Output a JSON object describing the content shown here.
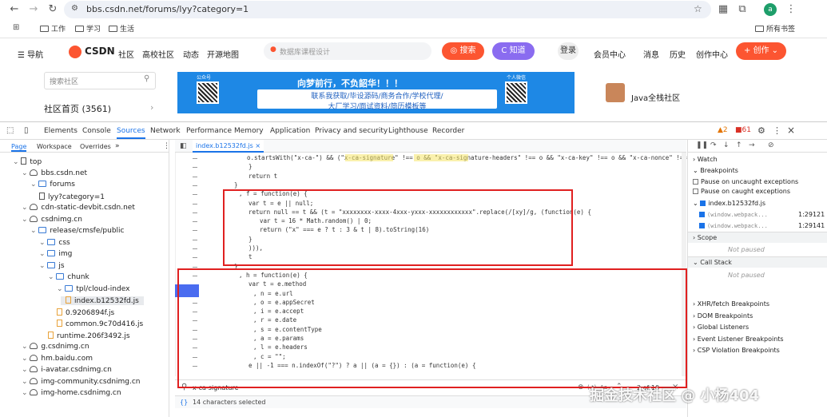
{
  "browser": {
    "url": "bbs.csdn.net/forums/lyy?category=1",
    "avatar_letter": "a",
    "bookmarks": [
      "工作",
      "学习",
      "生活"
    ],
    "all_bookmarks": "所有书签"
  },
  "site": {
    "nav_items": [
      "导航",
      "社区",
      "高校社区",
      "动态",
      "开源地图"
    ],
    "logo": "CSDN",
    "search_placeholder": "数据库课程设计",
    "search_button": "搜索",
    "zhidao_button": "知道",
    "login": "登录",
    "right_items": [
      "会员中心",
      "消息",
      "历史",
      "创作中心"
    ],
    "create_button": "创作",
    "sidebar_search_placeholder": "搜索社区",
    "community_home": "社区首页 (3561)",
    "banner_title": "向梦前行，不负韶华！！！",
    "banner_subtitle": "联系我获取/毕设源码/商务合作/学校代理/",
    "banner_subtitle2": "大厂学习/面试资料/简历模板等",
    "banner_left_label": "公众号",
    "banner_right_label": "个人微信",
    "community_name": "Java全栈社区"
  },
  "devtools": {
    "tabs": [
      "Elements",
      "Console",
      "Sources",
      "Network",
      "Performance",
      "Memory",
      "Application",
      "Privacy and security",
      "Lighthouse",
      "Recorder"
    ],
    "active_tab": "Sources",
    "warnings": "2",
    "errors": "61",
    "nav_tabs": [
      "Page",
      "Workspace",
      "Overrides"
    ],
    "file_tab": "index.b12532fd.js",
    "tree": [
      {
        "label": "top",
        "indent": 0,
        "icon": "frame"
      },
      {
        "label": "bbs.csdn.net",
        "indent": 1,
        "icon": "cloud"
      },
      {
        "label": "forums",
        "indent": 2,
        "icon": "folder"
      },
      {
        "label": "lyy?category=1",
        "indent": 3,
        "icon": "file"
      },
      {
        "label": "cdn-static-devbit.csdn.net",
        "indent": 1,
        "icon": "cloud"
      },
      {
        "label": "csdnimg.cn",
        "indent": 1,
        "icon": "cloud"
      },
      {
        "label": "release/cmsfe/public",
        "indent": 2,
        "icon": "folder"
      },
      {
        "label": "css",
        "indent": 3,
        "icon": "folder"
      },
      {
        "label": "img",
        "indent": 3,
        "icon": "folder"
      },
      {
        "label": "js",
        "indent": 3,
        "icon": "folder"
      },
      {
        "label": "chunk",
        "indent": 4,
        "icon": "folder"
      },
      {
        "label": "tpl/cloud-index",
        "indent": 5,
        "icon": "folder"
      },
      {
        "label": "index.b12532fd.js",
        "indent": 6,
        "icon": "jsfile"
      },
      {
        "label": "0.9206894f.js",
        "indent": 5,
        "icon": "jsfile"
      },
      {
        "label": "common.9c70d416.js",
        "indent": 5,
        "icon": "jsfile"
      },
      {
        "label": "runtime.206f3492.js",
        "indent": 4,
        "icon": "jsfile"
      },
      {
        "label": "g.csdnimg.cn",
        "indent": 1,
        "icon": "cloud"
      },
      {
        "label": "hm.baidu.com",
        "indent": 1,
        "icon": "cloud"
      },
      {
        "label": "i-avatar.csdnimg.cn",
        "indent": 1,
        "icon": "cloud"
      },
      {
        "label": "img-community.csdnimg.cn",
        "indent": 1,
        "icon": "cloud"
      },
      {
        "label": "img-home.csdnimg.cn",
        "indent": 1,
        "icon": "cloud"
      }
    ],
    "code_lines": [
      "o.startsWith(\"x-ca-\") && (\"x-ca-signature\" !== o && \"x-ca-signature-headers\" !== o && \"x-ca-key\" !== o && \"x-ca-nonce\" !== o ||",
      "}",
      "return t",
      "}",
      ", f = function(e) {",
      "var t = e || null;",
      "return null == t && (t = \"xxxxxxxx-xxxx-4xxx-yxxx-xxxxxxxxxxxx\".replace(/[xy]/g, (function(e) {",
      "var t = 16 * Math.random() | 0;",
      "return (\"x\" === e ? t : 3 & t | 8).toString(16)",
      "}",
      "))),",
      "t",
      "}",
      ", h = function(e) {",
      "var t = e.method",
      ", n = e.url",
      ", o = e.appSecret",
      ", i = e.accept",
      ", r = e.date",
      ", s = e.contentType",
      ", a = e.params",
      ", l = e.headers",
      ", c = \"\";",
      "e || -1 === n.indexOf(\"?\") ? a || (a = {}) : (a = function(e) {"
    ],
    "search_query": "x-ca-signature",
    "search_count": "2 of 10",
    "status": "14 characters selected",
    "right_panel": {
      "watch": "Watch",
      "breakpoints": "Breakpoints",
      "pause_uncaught": "Pause on uncaught exceptions",
      "pause_caught": "Pause on caught exceptions",
      "bp_file": "index.b12532fd.js",
      "bp1_code": "(window.webpack...",
      "bp1_line": "1:29121",
      "bp2_code": "(window.webpack...",
      "bp2_line": "1:29141",
      "scope": "Scope",
      "not_paused": "Not paused",
      "call_stack": "Call Stack",
      "not_paused2": "Not paused",
      "sections": [
        "XHR/fetch Breakpoints",
        "DOM Breakpoints",
        "Global Listeners",
        "Event Listener Breakpoints",
        "CSP Violation Breakpoints"
      ]
    }
  },
  "watermark": "掘金技术社区 @ 小杨404"
}
